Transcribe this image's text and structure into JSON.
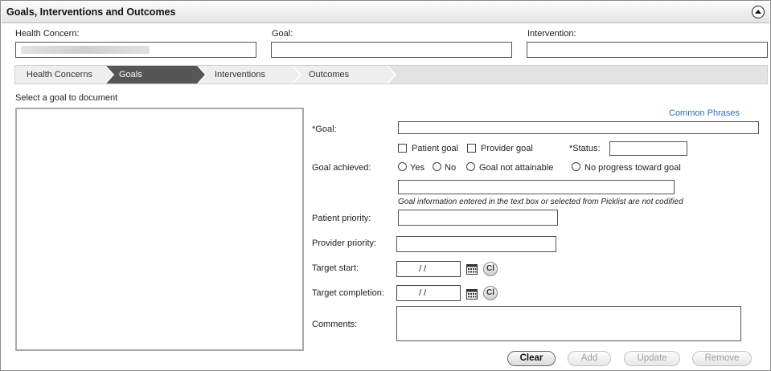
{
  "panel": {
    "title": "Goals, Interventions and Outcomes"
  },
  "summary": {
    "health_concern_label": "Health Concern:",
    "goal_label": "Goal:",
    "intervention_label": "Intervention:",
    "goal_value": "",
    "intervention_value": ""
  },
  "steps": [
    {
      "label": "Health Concerns",
      "active": false
    },
    {
      "label": "Goals",
      "active": true
    },
    {
      "label": "Interventions",
      "active": false
    },
    {
      "label": "Outcomes",
      "active": false
    }
  ],
  "goal_list": {
    "instruction": "Select a goal to document"
  },
  "form": {
    "common_phrases_link": "Common Phrases",
    "goal_label": "*Goal:",
    "goal_value": "",
    "patient_goal_label": "Patient goal",
    "provider_goal_label": "Provider goal",
    "status_label": "*Status:",
    "status_value": "",
    "goal_achieved_label": "Goal achieved:",
    "achieved_options": [
      "Yes",
      "No",
      "Goal not attainable",
      "No progress toward goal"
    ],
    "achieved_note_value": "",
    "note": "Goal information entered in the text box or selected from Picklist are not codified",
    "patient_priority_label": "Patient priority:",
    "patient_priority_value": "",
    "provider_priority_label": "Provider priority:",
    "provider_priority_value": "",
    "target_start_label": "Target start:",
    "target_start_value": "/ /",
    "target_completion_label": "Target completion:",
    "target_completion_value": "/ /",
    "clear_icon_text": "Cl",
    "comments_label": "Comments:",
    "comments_value": ""
  },
  "actions": {
    "clear": "Clear",
    "add": "Add",
    "update": "Update",
    "remove": "Remove"
  },
  "colors": {
    "active_step": "#565656",
    "link": "#2a6ebb",
    "step_bar": "#e3e3e3"
  },
  "icons": {
    "collapse": "chevron-up-circle-icon",
    "calendar": "calendar-icon"
  }
}
